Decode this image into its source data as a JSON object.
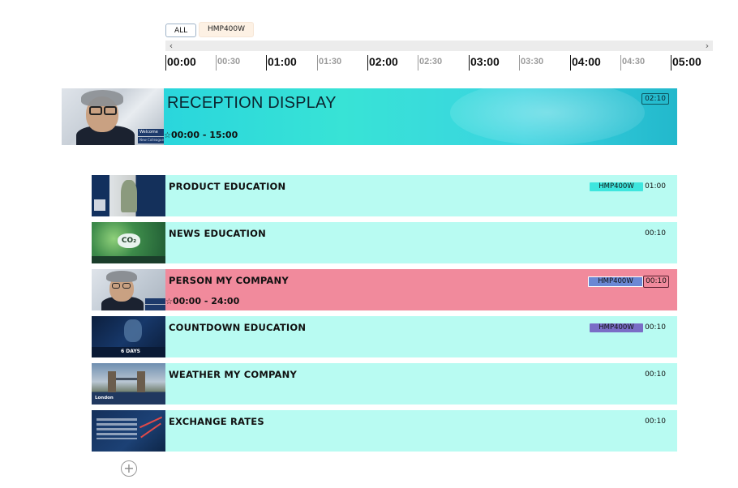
{
  "filters": {
    "all_label": "ALL",
    "device_label": "HMP400W"
  },
  "scroll": {
    "left_arrow": "‹",
    "right_arrow": "›"
  },
  "timeline": {
    "ticks": [
      {
        "label": "00:00",
        "major": true
      },
      {
        "label": "00:30",
        "major": false
      },
      {
        "label": "01:00",
        "major": true
      },
      {
        "label": "01:30",
        "major": false
      },
      {
        "label": "02:00",
        "major": true
      },
      {
        "label": "02:30",
        "major": false
      },
      {
        "label": "03:00",
        "major": true
      },
      {
        "label": "03:30",
        "major": false
      },
      {
        "label": "04:00",
        "major": true
      },
      {
        "label": "04:30",
        "major": false
      },
      {
        "label": "05:00",
        "major": true
      }
    ]
  },
  "main": {
    "title": "RECEPTION DISPLAY",
    "time_range": "00:00 - 15:00",
    "duration": "02:10",
    "thumb_welcome": "Welcome",
    "thumb_sub": "New Colleague"
  },
  "rows": [
    {
      "title": "PRODUCT EDUCATION",
      "tag": "HMP400W",
      "tag_color": "#3ee6de",
      "duration": "01:00",
      "time": ""
    },
    {
      "title": "NEWS EDUCATION",
      "tag": "",
      "duration": "00:10",
      "time": ""
    },
    {
      "title": "PERSON MY COMPANY",
      "tag": "HMP400W",
      "tag_color": "#6b88d4",
      "duration": "00:10",
      "time": "00:00 - 24:00",
      "highlight": true
    },
    {
      "title": "COUNTDOWN EDUCATION",
      "tag": "HMP400W",
      "tag_color": "#7a6dc6",
      "duration": "00:10",
      "time": ""
    },
    {
      "title": "WEATHER MY COMPANY",
      "tag": "",
      "duration": "00:10",
      "time": ""
    },
    {
      "title": "EXCHANGE RATES",
      "tag": "",
      "duration": "00:10",
      "time": ""
    }
  ],
  "thumb_text": {
    "co2": "CO₂",
    "days": "6 DAYS",
    "city": "London"
  },
  "colors": {
    "row_bg": "#b8fbf2",
    "highlight_bg": "#f18a9c",
    "main_bg": "#2ad6dc"
  },
  "icons": {
    "add": "plus-circle-icon",
    "star": "star-icon"
  }
}
